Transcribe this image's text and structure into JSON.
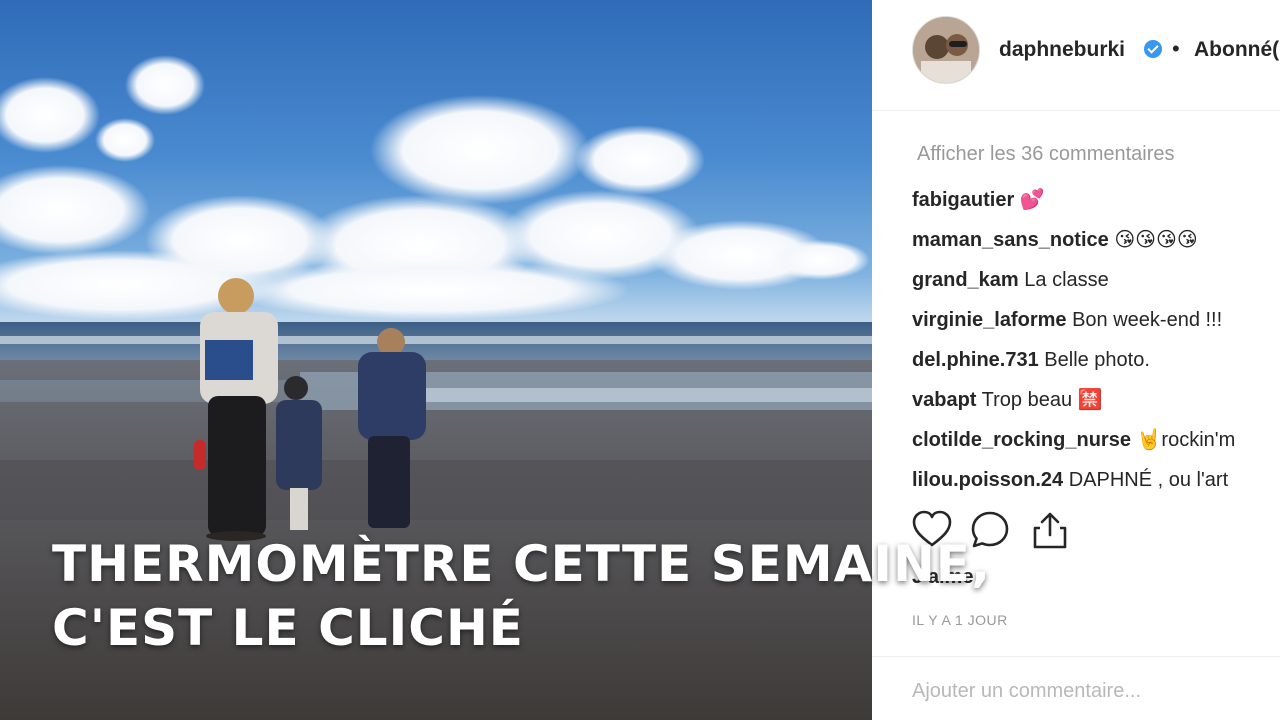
{
  "post": {
    "username": "daphneburki",
    "follow_label": "Abonné(e)",
    "separator": "•",
    "view_comments_label": "Afficher les 36 commentaires",
    "comments": [
      {
        "user": "fabigautier",
        "text": "💕"
      },
      {
        "user": "maman_sans_notice",
        "text": "😘😘😘😘"
      },
      {
        "user": "grand_kam",
        "text": "La classe"
      },
      {
        "user": "virginie_laforme",
        "text": "Bon week-end !!!"
      },
      {
        "user": "del.phine.731",
        "text": "Belle photo."
      },
      {
        "user": "vabapt",
        "text": "Trop beau 🈲"
      },
      {
        "user": "clotilde_rocking_nurse",
        "text": "🤘rockin'm"
      },
      {
        "user": "lilou.poisson.24",
        "text": "DAPHNÉ , ou l'art"
      }
    ],
    "likes_label": "J'aime",
    "time_label": "IL Y A 1 JOUR",
    "add_comment_placeholder": "Ajouter un commentaire..."
  },
  "icons": {
    "like": "heart-icon",
    "comment": "comment-bubble-icon",
    "share": "share-icon",
    "verified": "verified-badge-icon"
  },
  "colors": {
    "verified_blue": "#3897f0",
    "username_text": "#262626",
    "muted_text": "#999999"
  },
  "caption": {
    "line1": "THERMOMÈTRE CETTE SEMAINE,",
    "line2": "C'EST LE CLICHÉ"
  }
}
